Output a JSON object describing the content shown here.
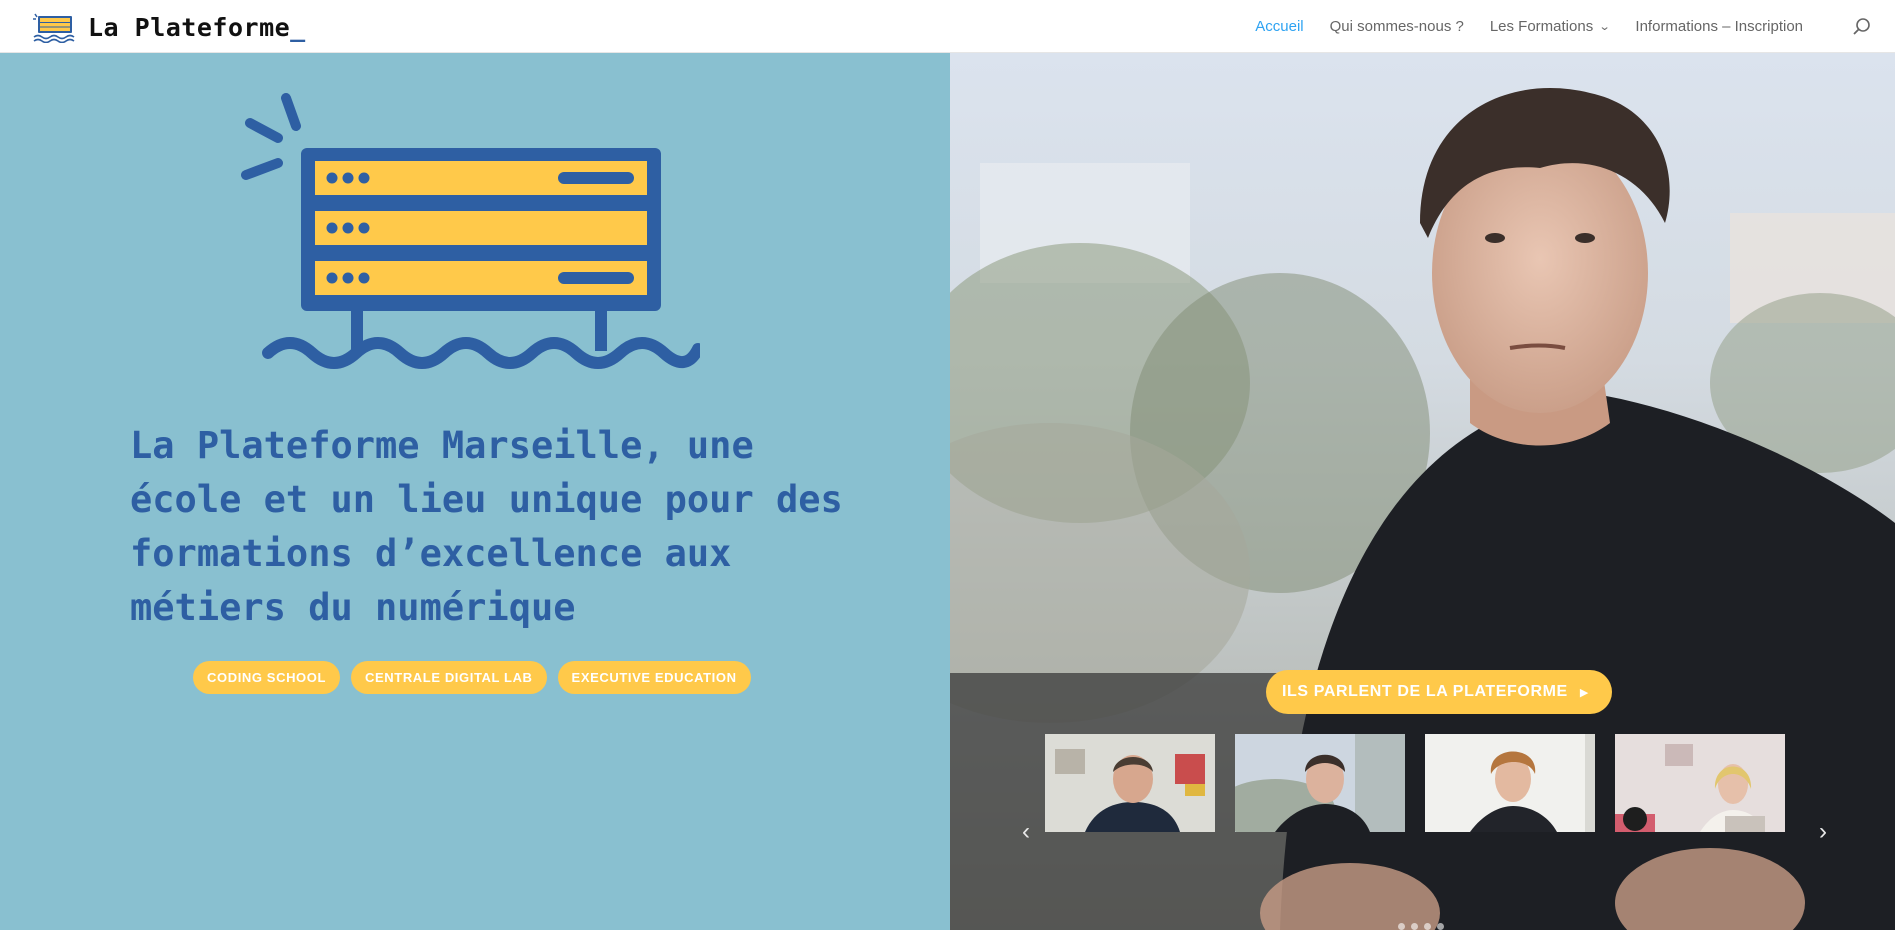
{
  "brand": {
    "name": "La Plateforme",
    "cursor": "_"
  },
  "nav": {
    "items": [
      {
        "label": "Accueil",
        "active": true
      },
      {
        "label": "Qui sommes-nous ?"
      },
      {
        "label": "Les Formations",
        "dropdown": true
      },
      {
        "label": "Informations – Inscription"
      }
    ],
    "search_icon": "search-icon"
  },
  "hero": {
    "title": "La Plateforme Marseille, une école et un lieu unique pour des formations d’excellence aux métiers du numérique",
    "pills": [
      "CODING SCHOOL",
      "CENTRALE DIGITAL LAB",
      "EXECUTIVE EDUCATION"
    ]
  },
  "video": {
    "cta_label": "ILS PARLENT DE LA PLATEFORME",
    "thumbnail_count": 4,
    "dot_count": 4
  },
  "colors": {
    "hero_bg": "#89c0d0",
    "primary_blue": "#2e5fa3",
    "accent_yellow": "#ffc94a",
    "nav_active": "#2ea3f2",
    "nav_text": "#666666"
  }
}
